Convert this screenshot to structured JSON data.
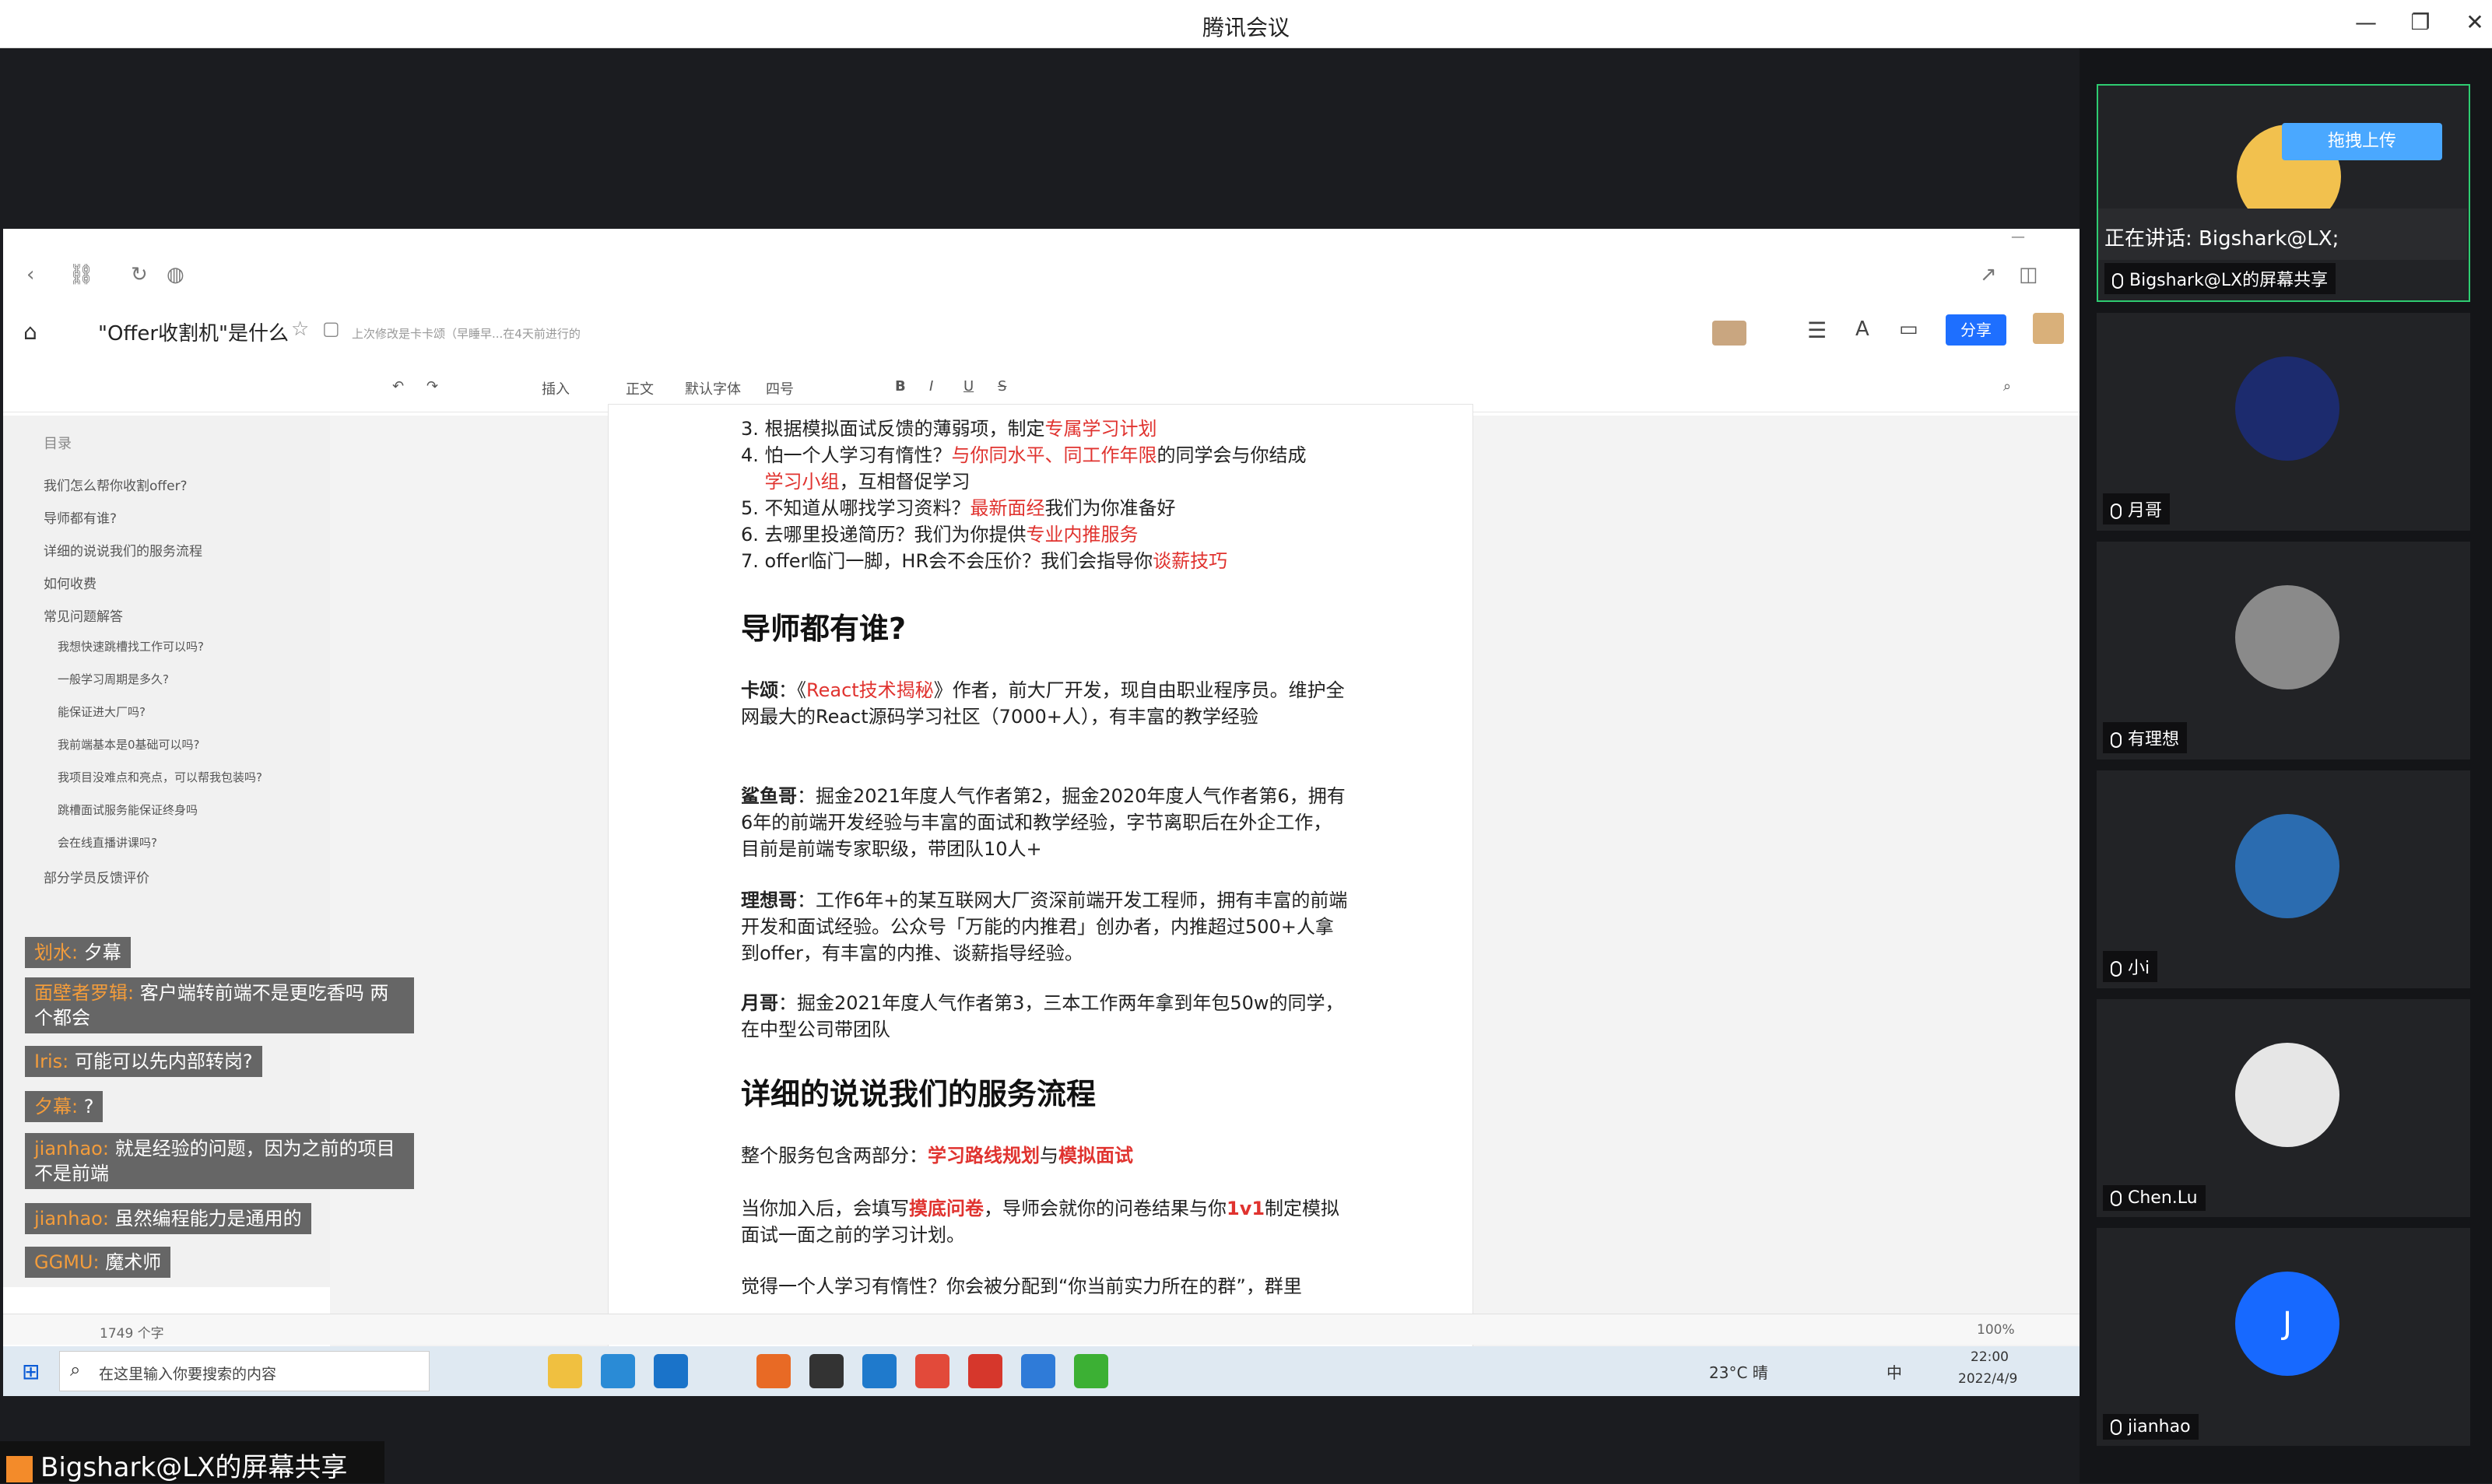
{
  "window": {
    "title": "腾讯会议",
    "controls": [
      "—",
      "❐",
      "✕"
    ]
  },
  "browser": {
    "doc_title": "\"Offer收割机\"是什么",
    "last_edit": "上次修改是卡卡颂（早睡早...在4天前进行的",
    "share_button": "分享",
    "toolbar": [
      "插入",
      "正文",
      "默认字体",
      "四号",
      "B",
      "I",
      "U",
      "S"
    ]
  },
  "toc": {
    "title": "目录",
    "items": [
      {
        "label": "我们怎么帮你收割offer?",
        "level": 1
      },
      {
        "label": "导师都有谁?",
        "level": 1
      },
      {
        "label": "详细的说说我们的服务流程",
        "level": 1
      },
      {
        "label": "如何收费",
        "level": 1
      },
      {
        "label": "常见问题解答",
        "level": 1
      },
      {
        "label": "我想快速跳槽找工作可以吗?",
        "level": 2
      },
      {
        "label": "一般学习周期是多久?",
        "level": 2
      },
      {
        "label": "能保证进大厂吗?",
        "level": 2
      },
      {
        "label": "我前端基本是0基础可以吗?",
        "level": 2
      },
      {
        "label": "我项目没难点和亮点，可以帮我包装吗?",
        "level": 2
      },
      {
        "label": "跳槽面试服务能保证终身吗",
        "level": 2
      },
      {
        "label": "会在线直播讲课吗?",
        "level": 2
      },
      {
        "label": "部分学员反馈评价",
        "level": 1
      }
    ]
  },
  "doc": {
    "list_items": [
      {
        "n": "3.",
        "pre": "根据模拟面试反馈的薄弱项，制定",
        "red": "专属学习计划",
        "post": ""
      },
      {
        "n": "4.",
        "pre": "怕一个人学习有惰性？",
        "red": "与你同水平、同工作年限",
        "post": "的同学会与你结成"
      },
      {
        "n": "5.",
        "pre": "不知道从哪找学习资料？",
        "red": "最新面经",
        "post": "我们为你准备好"
      },
      {
        "n": "6.",
        "pre": "去哪里投递简历？我们为你提供",
        "red": "专业内推服务",
        "post": ""
      },
      {
        "n": "7.",
        "pre": "offer临门一脚，HR会不会压价？我们会指导你",
        "red": "谈薪技巧",
        "post": ""
      }
    ],
    "item4_line2_red": "学习小组",
    "item4_line2_post": "，互相督促学习",
    "h_mentors": "导师都有谁?",
    "mentor1_name": "卡颂",
    "mentor1_text_a": "：《",
    "mentor1_book": "React技术揭秘",
    "mentor1_text_b": "》作者，前大厂开发，现自由职业程序员。维护全网最大的React源码学习社区（7000+人），有丰富的教学经验",
    "mentor2_name": "鲨鱼哥",
    "mentor2_text": "：掘金2021年度人气作者第2，掘金2020年度人气作者第6，拥有6年的前端开发经验与丰富的面试和教学经验，字节离职后在外企工作， 目前是前端专家职级，带团队10人+",
    "mentor3_name": "理想哥",
    "mentor3_text": "：工作6年+的某互联网大厂资深前端开发工程师，拥有丰富的前端开发和面试经验。公众号「万能的内推君」创办者，内推超过500+人拿到offer，有丰富的内推、谈薪指导经验。",
    "mentor4_name": "月哥",
    "mentor4_text": "：掘金2021年度人气作者第3，三本工作两年拿到年包50w的同学，在中型公司带团队",
    "h_process": "详细的说说我们的服务流程",
    "process_p1_pre": "整个服务包含两部分：",
    "process_p1_r1": "学习路线规划",
    "process_p1_mid": "与",
    "process_p1_r2": "模拟面试",
    "process_p2_a": "当你加入后，会填写",
    "process_p2_r1": "摸底问卷",
    "process_p2_b": "，导师会就你的问卷结果与你",
    "process_p2_r2": "1v1",
    "process_p2_c": "制定模拟面试一面之前的学习计划。",
    "process_p3": "觉得一个人学习有惰性？你会被分配到“你当前实力所在的群”，群里"
  },
  "chat": [
    {
      "who": "划水:",
      "msg": "夕幕"
    },
    {
      "who": "面壁者罗辑:",
      "msg": "客户端转前端不是更吃香吗  两个都会"
    },
    {
      "who": "Iris:",
      "msg": "可能可以先内部转岗?"
    },
    {
      "who": "夕幕:",
      "msg": "?"
    },
    {
      "who": "jianhao:",
      "msg": "就是经验的问题，因为之前的项目不是前端"
    },
    {
      "who": "jianhao:",
      "msg": "虽然编程能力是通用的"
    },
    {
      "who": "GGMU:",
      "msg": "魔术师"
    }
  ],
  "statusbar": {
    "word_count": "1749 个字",
    "zoom": "100%"
  },
  "taskbar": {
    "search_placeholder": "在这里输入你要搜索的内容",
    "weather": "23°C 晴",
    "ime": "中",
    "time": "22:00",
    "date": "2022/4/9"
  },
  "presenter_label": "Bigshark@LX的屏幕共享",
  "participants": {
    "upload_button": "拖拽上传",
    "speaking": "正在讲话: Bigshark@LX;",
    "tiles": [
      {
        "name": "Bigshark@LX的屏幕共享",
        "avatar_color": "#f2c14e"
      },
      {
        "name": "月哥",
        "avatar_color": "#1c2b6e"
      },
      {
        "name": "有理想",
        "avatar_color": "#8a8a8a"
      },
      {
        "name": "小i",
        "avatar_color": "#2b6cb0"
      },
      {
        "name": "Chen.Lu",
        "avatar_color": "#e6e6e6"
      },
      {
        "name": "jianhao",
        "avatar_color": "#1769ff",
        "initial": "J"
      }
    ]
  }
}
